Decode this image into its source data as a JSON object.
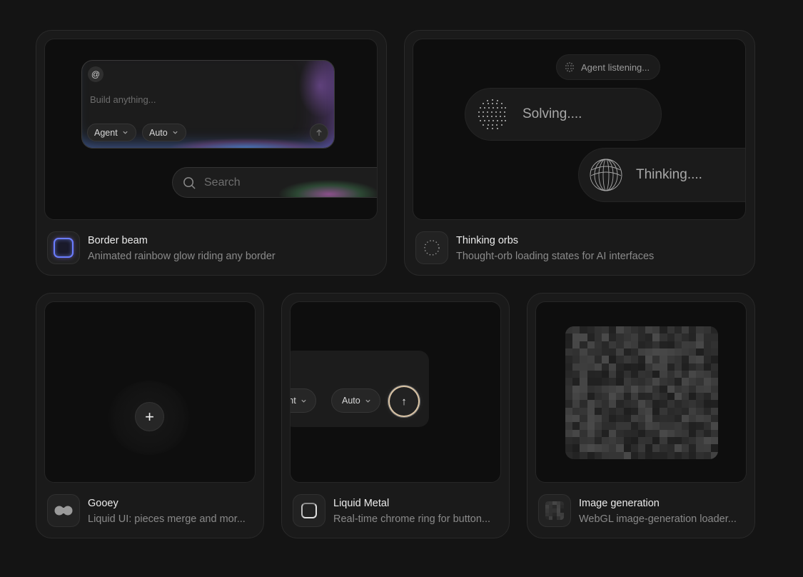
{
  "cards": {
    "border_beam": {
      "title": "Border beam",
      "description": "Animated rainbow glow riding any border",
      "preview": {
        "at_symbol": "@",
        "composer_placeholder": "Build anything...",
        "mode_pill": "Agent",
        "model_pill": "Auto",
        "search_placeholder": "Search"
      }
    },
    "thinking_orbs": {
      "title": "Thinking orbs",
      "description": "Thought-orb loading states for AI interfaces",
      "preview": {
        "chip_small": "Agent listening...",
        "chip_solving": "Solving....",
        "chip_thinking": "Thinking...."
      }
    },
    "gooey": {
      "title": "Gooey",
      "description": "Liquid UI: pieces merge and mor...",
      "preview": {
        "plus": "+"
      }
    },
    "liquid_metal": {
      "title": "Liquid Metal",
      "description": "Real-time chrome ring for button...",
      "preview": {
        "mode_pill": "Agent",
        "model_pill": "Auto",
        "send_arrow": "↑"
      }
    },
    "image_generation": {
      "title": "Image generation",
      "description": "WebGL image-generation loader..."
    }
  },
  "icons": {
    "chevron": "chevron-down-icon",
    "search": "search-icon",
    "send": "arrow-up-icon"
  }
}
